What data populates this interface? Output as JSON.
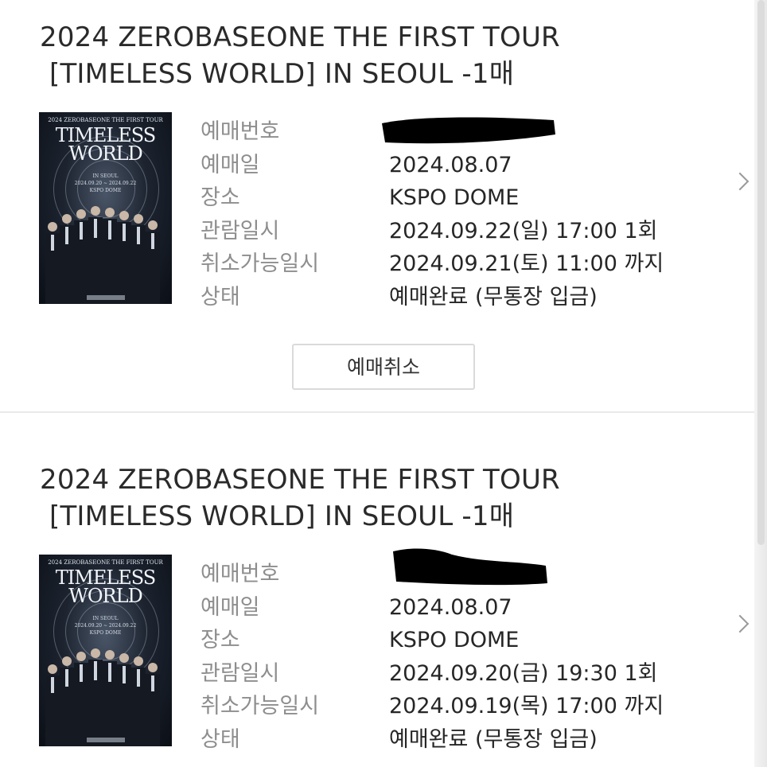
{
  "bookings": [
    {
      "title_line1": "2024 ZEROBASEONE THE FIRST TOUR",
      "title_line2": "[TIMELESS WORLD]  IN SEOUL -1매",
      "poster": {
        "top": "2024 ZEROBASEONE THE FIRST TOUR",
        "main1": "TIMELESS",
        "main2": "WORLD",
        "city": "IN SEOUL",
        "dates": "2024.09.20 ~ 2024.09.22",
        "venue": "KSPO DOME"
      },
      "rows": [
        {
          "label": "예매번호",
          "value": ""
        },
        {
          "label": "예매일",
          "value": "2024.08.07"
        },
        {
          "label": "장소",
          "value": "KSPO DOME"
        },
        {
          "label": "관람일시",
          "value": "2024.09.22(일) 17:00 1회"
        },
        {
          "label": "취소가능일시",
          "value": "2024.09.21(토) 11:00 까지"
        },
        {
          "label": "상태",
          "value": "예매완료 (무통장 입금)"
        }
      ],
      "cancel_label": "예매취소"
    },
    {
      "title_line1": "2024 ZEROBASEONE THE FIRST TOUR",
      "title_line2": "[TIMELESS WORLD]  IN SEOUL -1매",
      "poster": {
        "top": "2024 ZEROBASEONE THE FIRST TOUR",
        "main1": "TIMELESS",
        "main2": "WORLD",
        "city": "IN SEOUL",
        "dates": "2024.09.20 ~ 2024.09.22",
        "venue": "KSPO DOME"
      },
      "rows": [
        {
          "label": "예매번호",
          "value": ""
        },
        {
          "label": "예매일",
          "value": "2024.08.07"
        },
        {
          "label": "장소",
          "value": "KSPO DOME"
        },
        {
          "label": "관람일시",
          "value": "2024.09.20(금) 19:30 1회"
        },
        {
          "label": "취소가능일시",
          "value": "2024.09.19(목) 17:00 까지"
        },
        {
          "label": "상태",
          "value": "예매완료 (무통장 입금)"
        }
      ]
    }
  ],
  "icons": {
    "detail": "chevron-right-icon",
    "redaction": "redacted-booking-number"
  },
  "colors": {
    "label": "#8e8e8e",
    "value": "#262626",
    "divider": "#e9e9e9",
    "button_border": "#dadada"
  }
}
